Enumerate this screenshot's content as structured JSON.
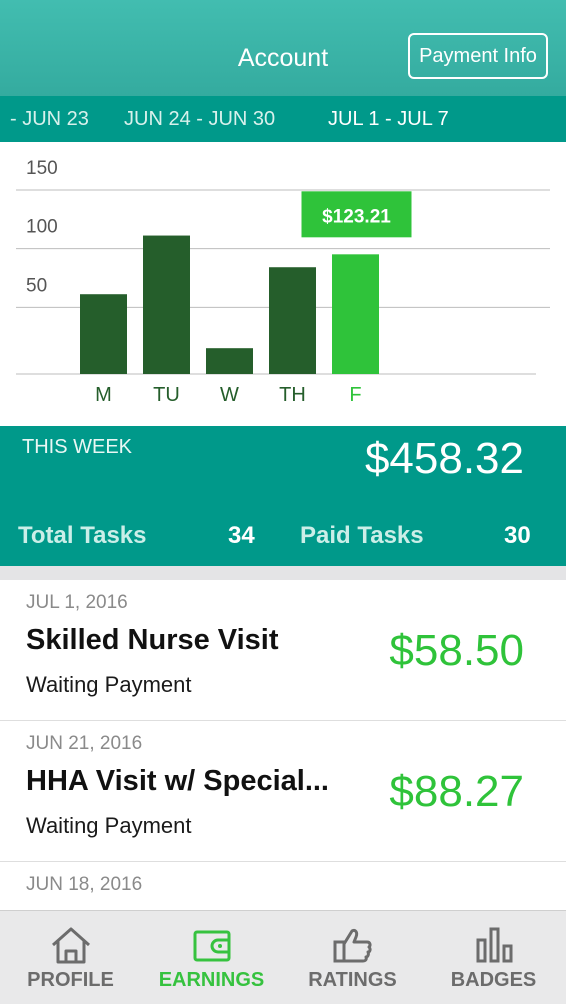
{
  "header": {
    "title": "Account",
    "payment_info_label": "Payment Info"
  },
  "weeks": [
    {
      "label": "- JUN 23",
      "active": false
    },
    {
      "label": "JUN 24 - JUN 30",
      "active": false
    },
    {
      "label": "JUL 1 - JUL 7",
      "active": true
    }
  ],
  "colors": {
    "bar": "#255e2b",
    "bar_selected": "#2fc33a",
    "header": "#3cb6a9",
    "band": "#00998a"
  },
  "chart_data": {
    "type": "bar",
    "categories": [
      "M",
      "TU",
      "W",
      "TH",
      "F"
    ],
    "values": [
      68,
      118,
      22,
      91,
      102
    ],
    "yticks": [
      50,
      100,
      150
    ],
    "ylim": [
      0,
      150
    ],
    "selected_index": 4,
    "tooltip": "$123.21"
  },
  "summary": {
    "label": "THIS WEEK",
    "amount": "$458.32",
    "total_tasks_label": "Total Tasks",
    "total_tasks": "34",
    "paid_tasks_label": "Paid Tasks",
    "paid_tasks": "30"
  },
  "tasks": [
    {
      "date": "JUL 1, 2016",
      "title": "Skilled Nurse Visit",
      "status": "Waiting Payment",
      "amount": "$58.50"
    },
    {
      "date": "JUN 21, 2016",
      "title": "HHA Visit w/ Special...",
      "status": "Waiting Payment",
      "amount": "$88.27"
    },
    {
      "date": "JUN 18, 2016",
      "title": "",
      "status": "",
      "amount": ""
    }
  ],
  "tabs": [
    {
      "label": "PROFILE",
      "icon": "home-icon",
      "active": false
    },
    {
      "label": "EARNINGS",
      "icon": "wallet-icon",
      "active": true
    },
    {
      "label": "RATINGS",
      "icon": "thumbs-up-icon",
      "active": false
    },
    {
      "label": "BADGES",
      "icon": "bar-chart-icon",
      "active": false
    }
  ]
}
